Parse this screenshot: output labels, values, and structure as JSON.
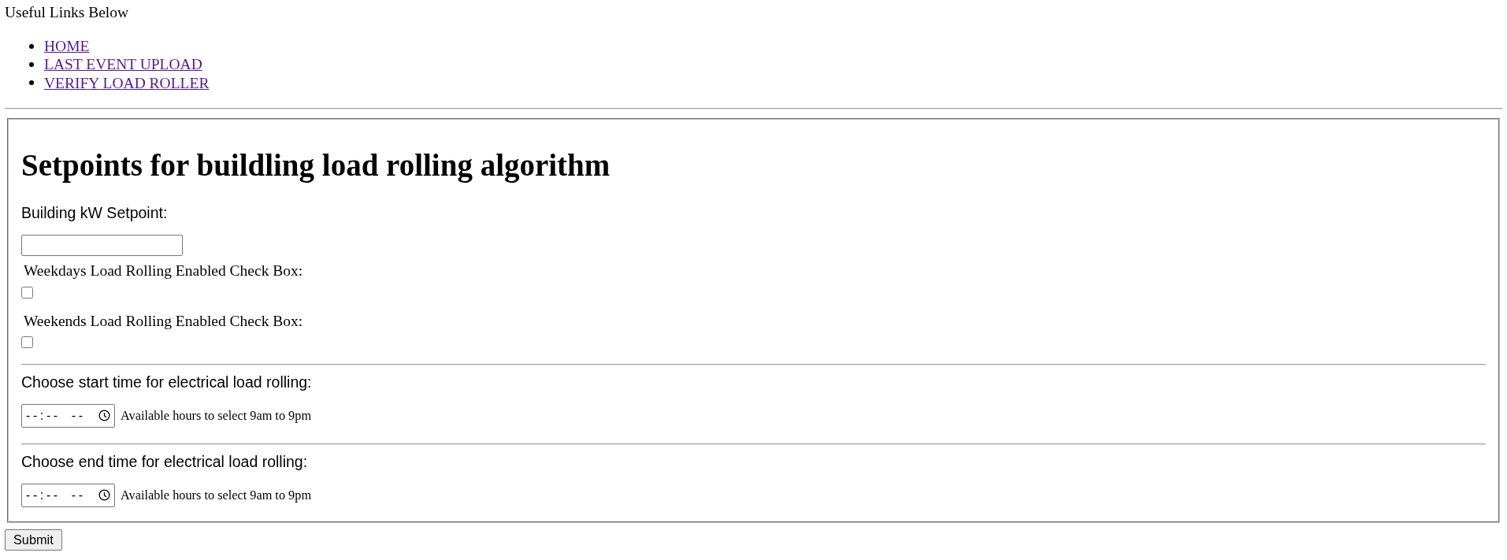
{
  "header": {
    "text": "Useful Links Below"
  },
  "links": [
    {
      "label": "HOME",
      "visited": true
    },
    {
      "label": "LAST EVENT UPLOAD",
      "visited": true
    },
    {
      "label": "VERIFY LOAD ROLLER",
      "visited": true
    }
  ],
  "form": {
    "title": "Setpoints for buildling load rolling algorithm",
    "fields": [
      {
        "kind": "text",
        "label": "Building kW Setpoint:"
      },
      {
        "kind": "checkbox",
        "label": "Weekdays Load Rolling Enabled Check Box:",
        "checked": false
      },
      {
        "kind": "checkbox",
        "label": "Weekends Load Rolling Enabled Check Box:",
        "checked": false
      },
      {
        "kind": "time",
        "label": "Choose start time for electrical load rolling:",
        "placeholder": "--:-- --",
        "hint": "Available hours to select 9am to 9pm"
      },
      {
        "kind": "time",
        "label": "Choose end time for electrical load rolling:",
        "placeholder": "--:-- --",
        "hint": "Available hours to select 9am to 9pm"
      }
    ]
  },
  "submit_button": {
    "label": "Submit"
  }
}
